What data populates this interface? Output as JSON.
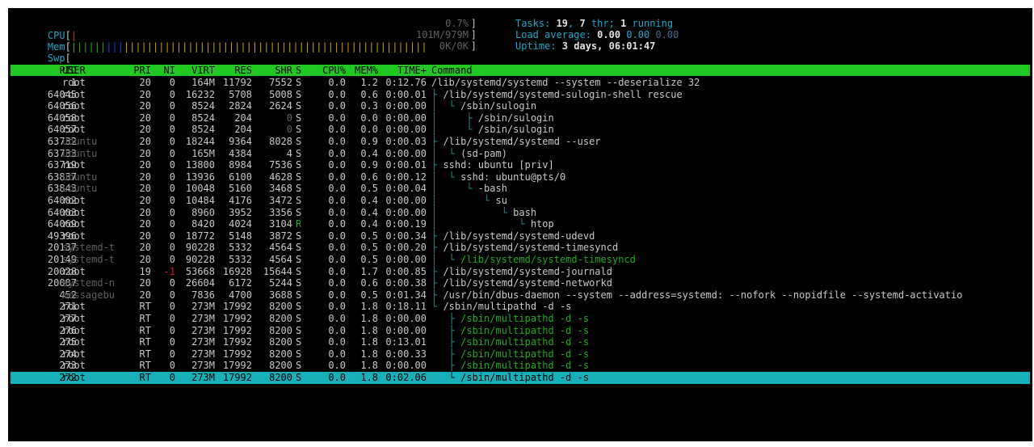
{
  "meters": {
    "cpu": {
      "label": "CPU",
      "value": "0.7%"
    },
    "mem": {
      "label": "Mem",
      "value": "101M/979M"
    },
    "swp": {
      "label": "Swp",
      "value": "0K/0K"
    }
  },
  "info": {
    "tasks_label": "Tasks: ",
    "tasks": "19",
    "thr_sep": ", ",
    "thr": "7",
    "thr_label": " thr; ",
    "running": "1",
    "running_label": " running",
    "load_label": "Load average: ",
    "load1": "0.00",
    "load5": "0.00",
    "load15": "0.00",
    "uptime_label": "Uptime: ",
    "uptime": "3 days, 06:01:47"
  },
  "columns": [
    "PID",
    "USER",
    "PRI",
    "NI",
    "VIRT",
    "RES",
    "SHR",
    "S",
    "CPU%",
    "MEM%",
    "TIME+",
    "Command"
  ],
  "processes": [
    {
      "pid": "1",
      "user": "root",
      "pri": "20",
      "ni": "0",
      "virt": "164M",
      "res": "11792",
      "shr": "7552",
      "s": "S",
      "cpu": "0.0",
      "mem": "1.2",
      "time": "0:12.76",
      "tree": "",
      "cmd": "/lib/systemd/systemd --system --deserialize 32"
    },
    {
      "pid": "64045",
      "user": "root",
      "pri": "20",
      "ni": "0",
      "virt": "16232",
      "res": "5708",
      "shr": "5008",
      "s": "S",
      "cpu": "0.0",
      "mem": "0.6",
      "time": "0:00.01",
      "tree": "├ ",
      "cmd": "/lib/systemd/systemd-sulogin-shell rescue"
    },
    {
      "pid": "64056",
      "user": "root",
      "pri": "20",
      "ni": "0",
      "virt": "8524",
      "res": "2824",
      "shr": "2624",
      "s": "S",
      "cpu": "0.0",
      "mem": "0.3",
      "time": "0:00.00",
      "tree": "│  └ ",
      "cmd": "/sbin/sulogin"
    },
    {
      "pid": "64058",
      "user": "root",
      "pri": "20",
      "ni": "0",
      "virt": "8524",
      "res": "204",
      "shr": "0",
      "s": "S",
      "cpu": "0.0",
      "mem": "0.0",
      "time": "0:00.00",
      "tree": "│     ├ ",
      "cmd": "/sbin/sulogin"
    },
    {
      "pid": "64057",
      "user": "root",
      "pri": "20",
      "ni": "0",
      "virt": "8524",
      "res": "204",
      "shr": "0",
      "s": "S",
      "cpu": "0.0",
      "mem": "0.0",
      "time": "0:00.00",
      "tree": "│     └ ",
      "cmd": "/sbin/sulogin"
    },
    {
      "pid": "63732",
      "user": "ubuntu",
      "pri": "20",
      "ni": "0",
      "virt": "18244",
      "res": "9364",
      "shr": "8028",
      "s": "S",
      "cpu": "0.0",
      "mem": "0.9",
      "time": "0:00.03",
      "tree": "├ ",
      "cmd": "/lib/systemd/systemd --user"
    },
    {
      "pid": "63733",
      "user": "ubuntu",
      "pri": "20",
      "ni": "0",
      "virt": "165M",
      "res": "4384",
      "shr": "4",
      "s": "S",
      "cpu": "0.0",
      "mem": "0.4",
      "time": "0:00.00",
      "tree": "│  └ ",
      "cmd": "(sd-pam)"
    },
    {
      "pid": "63719",
      "user": "root",
      "pri": "20",
      "ni": "0",
      "virt": "13800",
      "res": "8984",
      "shr": "7536",
      "s": "S",
      "cpu": "0.0",
      "mem": "0.9",
      "time": "0:00.01",
      "tree": "├ ",
      "cmd": "sshd: ubuntu [priv]"
    },
    {
      "pid": "63837",
      "user": "ubuntu",
      "pri": "20",
      "ni": "0",
      "virt": "13936",
      "res": "6100",
      "shr": "4628",
      "s": "S",
      "cpu": "0.0",
      "mem": "0.6",
      "time": "0:00.12",
      "tree": "│  └ ",
      "cmd": "sshd: ubuntu@pts/0"
    },
    {
      "pid": "63843",
      "user": "ubuntu",
      "pri": "20",
      "ni": "0",
      "virt": "10048",
      "res": "5160",
      "shr": "3468",
      "s": "S",
      "cpu": "0.0",
      "mem": "0.5",
      "time": "0:00.04",
      "tree": "│     └ ",
      "cmd": "-bash"
    },
    {
      "pid": "64002",
      "user": "root",
      "pri": "20",
      "ni": "0",
      "virt": "10484",
      "res": "4176",
      "shr": "3472",
      "s": "S",
      "cpu": "0.0",
      "mem": "0.4",
      "time": "0:00.00",
      "tree": "│        └ ",
      "cmd": "su"
    },
    {
      "pid": "64003",
      "user": "root",
      "pri": "20",
      "ni": "0",
      "virt": "8960",
      "res": "3952",
      "shr": "3356",
      "s": "S",
      "cpu": "0.0",
      "mem": "0.4",
      "time": "0:00.00",
      "tree": "│           └ ",
      "cmd": "bash"
    },
    {
      "pid": "64069",
      "user": "root",
      "pri": "20",
      "ni": "0",
      "virt": "8420",
      "res": "4024",
      "shr": "3104",
      "s": "R",
      "cpu": "0.0",
      "mem": "0.4",
      "time": "0:00.19",
      "tree": "│              └ ",
      "cmd": "htop"
    },
    {
      "pid": "49396",
      "user": "root",
      "pri": "20",
      "ni": "0",
      "virt": "18772",
      "res": "5148",
      "shr": "3872",
      "s": "S",
      "cpu": "0.0",
      "mem": "0.5",
      "time": "0:00.34",
      "tree": "├ ",
      "cmd": "/lib/systemd/systemd-udevd"
    },
    {
      "pid": "20137",
      "user": "systemd-t",
      "pri": "20",
      "ni": "0",
      "virt": "90228",
      "res": "5332",
      "shr": "4564",
      "s": "S",
      "cpu": "0.0",
      "mem": "0.5",
      "time": "0:00.20",
      "tree": "├ ",
      "cmd": "/lib/systemd/systemd-timesyncd"
    },
    {
      "pid": "20149",
      "user": "systemd-t",
      "pri": "20",
      "ni": "0",
      "virt": "90228",
      "res": "5332",
      "shr": "4564",
      "s": "S",
      "cpu": "0.0",
      "mem": "0.5",
      "time": "0:00.00",
      "tree": "│  └ ",
      "cmd": "/lib/systemd/systemd-timesyncd",
      "thread": true
    },
    {
      "pid": "20028",
      "user": "root",
      "pri": "19",
      "ni": "-1",
      "virt": "53668",
      "res": "16928",
      "shr": "15644",
      "s": "S",
      "cpu": "0.0",
      "mem": "1.7",
      "time": "0:00.85",
      "tree": "├ ",
      "cmd": "/lib/systemd/systemd-journald"
    },
    {
      "pid": "20007",
      "user": "systemd-n",
      "pri": "20",
      "ni": "0",
      "virt": "26604",
      "res": "6172",
      "shr": "5244",
      "s": "S",
      "cpu": "0.0",
      "mem": "0.6",
      "time": "0:00.38",
      "tree": "├ ",
      "cmd": "/lib/systemd/systemd-networkd"
    },
    {
      "pid": "452",
      "user": "messagebu",
      "pri": "20",
      "ni": "0",
      "virt": "7836",
      "res": "4700",
      "shr": "3688",
      "s": "S",
      "cpu": "0.0",
      "mem": "0.5",
      "time": "0:01.34",
      "tree": "├ ",
      "cmd": "/usr/bin/dbus-daemon --system --address=systemd: --nofork --nopidfile --systemd-activatio"
    },
    {
      "pid": "271",
      "user": "root",
      "pri": "RT",
      "ni": "0",
      "virt": "273M",
      "res": "17992",
      "shr": "8200",
      "s": "S",
      "cpu": "0.0",
      "mem": "1.8",
      "time": "0:18.11",
      "tree": "└ ",
      "cmd": "/sbin/multipathd -d -s"
    },
    {
      "pid": "277",
      "user": "root",
      "pri": "RT",
      "ni": "0",
      "virt": "273M",
      "res": "17992",
      "shr": "8200",
      "s": "S",
      "cpu": "0.0",
      "mem": "1.8",
      "time": "0:00.00",
      "tree": "   ├ ",
      "cmd": "/sbin/multipathd -d -s",
      "thread": true
    },
    {
      "pid": "276",
      "user": "root",
      "pri": "RT",
      "ni": "0",
      "virt": "273M",
      "res": "17992",
      "shr": "8200",
      "s": "S",
      "cpu": "0.0",
      "mem": "1.8",
      "time": "0:00.00",
      "tree": "   ├ ",
      "cmd": "/sbin/multipathd -d -s",
      "thread": true
    },
    {
      "pid": "275",
      "user": "root",
      "pri": "RT",
      "ni": "0",
      "virt": "273M",
      "res": "17992",
      "shr": "8200",
      "s": "S",
      "cpu": "0.0",
      "mem": "1.8",
      "time": "0:13.01",
      "tree": "   ├ ",
      "cmd": "/sbin/multipathd -d -s",
      "thread": true
    },
    {
      "pid": "274",
      "user": "root",
      "pri": "RT",
      "ni": "0",
      "virt": "273M",
      "res": "17992",
      "shr": "8200",
      "s": "S",
      "cpu": "0.0",
      "mem": "1.8",
      "time": "0:00.33",
      "tree": "   ├ ",
      "cmd": "/sbin/multipathd -d -s",
      "thread": true
    },
    {
      "pid": "273",
      "user": "root",
      "pri": "RT",
      "ni": "0",
      "virt": "273M",
      "res": "17992",
      "shr": "8200",
      "s": "S",
      "cpu": "0.0",
      "mem": "1.8",
      "time": "0:00.00",
      "tree": "   ├ ",
      "cmd": "/sbin/multipathd -d -s",
      "thread": true
    },
    {
      "pid": "272",
      "user": "root",
      "pri": "RT",
      "ni": "0",
      "virt": "273M",
      "res": "17992",
      "shr": "8200",
      "s": "S",
      "cpu": "0.0",
      "mem": "1.8",
      "time": "0:02.06",
      "tree": "   └ ",
      "cmd": "/sbin/multipathd -d -s",
      "thread": true,
      "selected": true
    }
  ],
  "colors": {
    "background": "#000000",
    "header_bar": "#22c822",
    "selected_row": "#18b0b8",
    "meter_label": "#20a8c8",
    "thread_text": "#22aa22",
    "dim_text": "#606060"
  }
}
